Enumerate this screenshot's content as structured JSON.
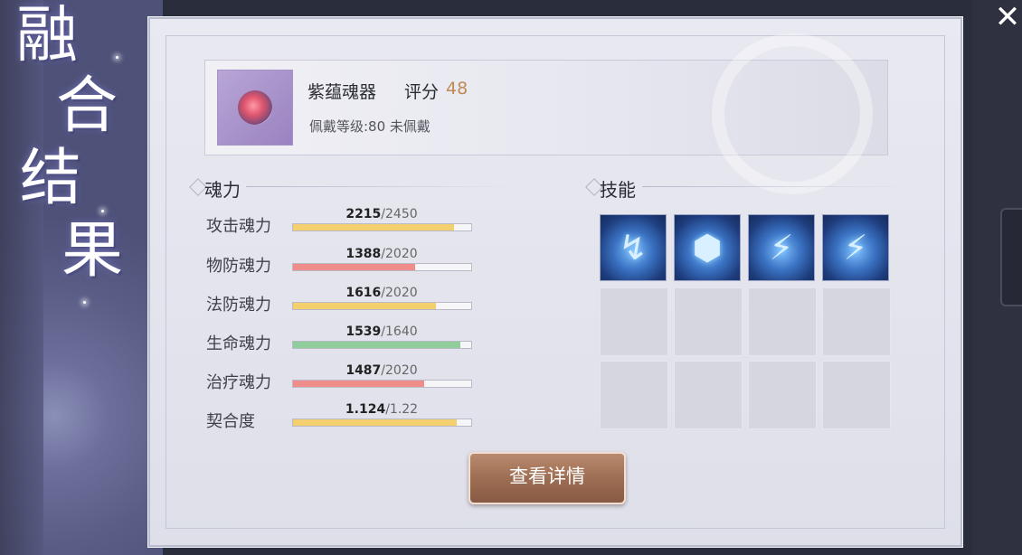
{
  "title_chars": [
    "融",
    "合",
    "结",
    "果"
  ],
  "close": {
    "glyph": "✕"
  },
  "item": {
    "name": "紫蕴魂器",
    "score_label": "评分",
    "score": "48",
    "sub": "佩戴等级:80 未佩戴",
    "icon": "purple-soul-gem-icon"
  },
  "soul_power": {
    "title": "魂力",
    "stats": [
      {
        "label": "攻击魂力",
        "current": "2215",
        "max": "/2450",
        "value": 2215,
        "maximum": 2450,
        "color": "#f4cf6e"
      },
      {
        "label": "物防魂力",
        "current": "1388",
        "max": "/2020",
        "value": 1388,
        "maximum": 2020,
        "color": "#ef8d8a"
      },
      {
        "label": "法防魂力",
        "current": "1616",
        "max": "/2020",
        "value": 1616,
        "maximum": 2020,
        "color": "#f4cf6e"
      },
      {
        "label": "生命魂力",
        "current": "1539",
        "max": "/1640",
        "value": 1539,
        "maximum": 1640,
        "color": "#8fce9a"
      },
      {
        "label": "治疗魂力",
        "current": "1487",
        "max": "/2020",
        "value": 1487,
        "maximum": 2020,
        "color": "#ef8d8a"
      },
      {
        "label": "契合度",
        "current": "1.124",
        "max": "/1.22",
        "value": 1.124,
        "maximum": 1.22,
        "color": "#f4cf6e"
      }
    ]
  },
  "skills": {
    "title": "技能",
    "icons": [
      {
        "name": "skill-arrow-heal-icon",
        "glyph": "↯"
      },
      {
        "name": "skill-shield-icon",
        "glyph": "⬢"
      },
      {
        "name": "skill-triple-strike-icon",
        "glyph": "⚡"
      },
      {
        "name": "skill-lightning-icon",
        "glyph": "⚡"
      }
    ],
    "empty_slots": 8
  },
  "detail_button": {
    "label": "查看详情"
  }
}
